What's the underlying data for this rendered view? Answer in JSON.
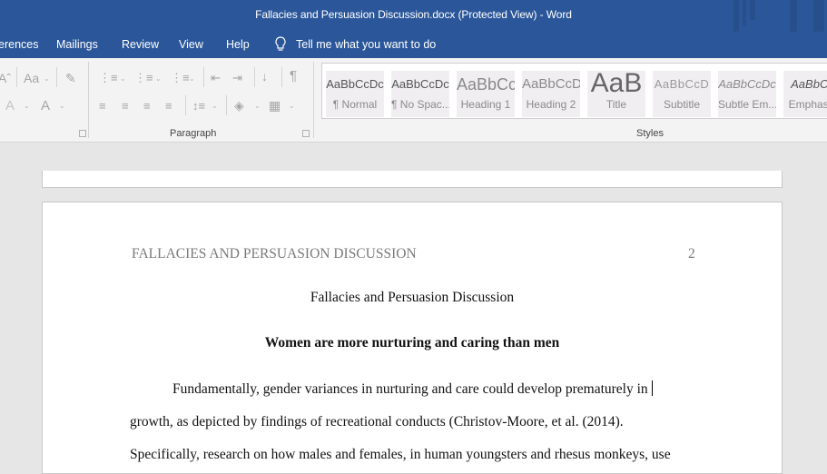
{
  "window": {
    "title": "Fallacies and Persuasion Discussion.docx (Protected View)  -  Word"
  },
  "menu": {
    "tabs": [
      "erences",
      "Mailings",
      "Review",
      "View",
      "Help"
    ],
    "tell_me": "Tell me what you want to do"
  },
  "ribbon": {
    "font_group": {
      "font_size_icon": "Aˆ",
      "change_case": "Aa",
      "text_effects": "A",
      "font_color": "A"
    },
    "paragraph_label": "Paragraph",
    "styles_label": "Styles",
    "styles": [
      {
        "preview": "AaBbCcDc",
        "name": "¶ Normal"
      },
      {
        "preview": "AaBbCcDc",
        "name": "¶ No Spac..."
      },
      {
        "preview": "AaBbCc",
        "name": "Heading 1"
      },
      {
        "preview": "AaBbCcD",
        "name": "Heading 2"
      },
      {
        "preview": "AaB",
        "name": "Title"
      },
      {
        "preview": "AaBbCcD",
        "name": "Subtitle"
      },
      {
        "preview": "AaBbCcDc",
        "name": "Subtle Em..."
      },
      {
        "preview": "AaBbCc",
        "name": "Emphasis"
      }
    ]
  },
  "document": {
    "running_head": "FALLACIES AND PERSUASION DISCUSSION",
    "page_number": "2",
    "title": "Fallacies and Persuasion Discussion",
    "heading": "Women are more nurturing and caring than men",
    "paragraph_lines": [
      "Fundamentally, gender variances in nurturing and care could develop prematurely in",
      "growth, as depicted by findings of recreational conducts (Christov-Moore, et al. (2014).",
      "Specifically, research on how males and females, in human youngsters and rhesus monkeys, use"
    ]
  }
}
